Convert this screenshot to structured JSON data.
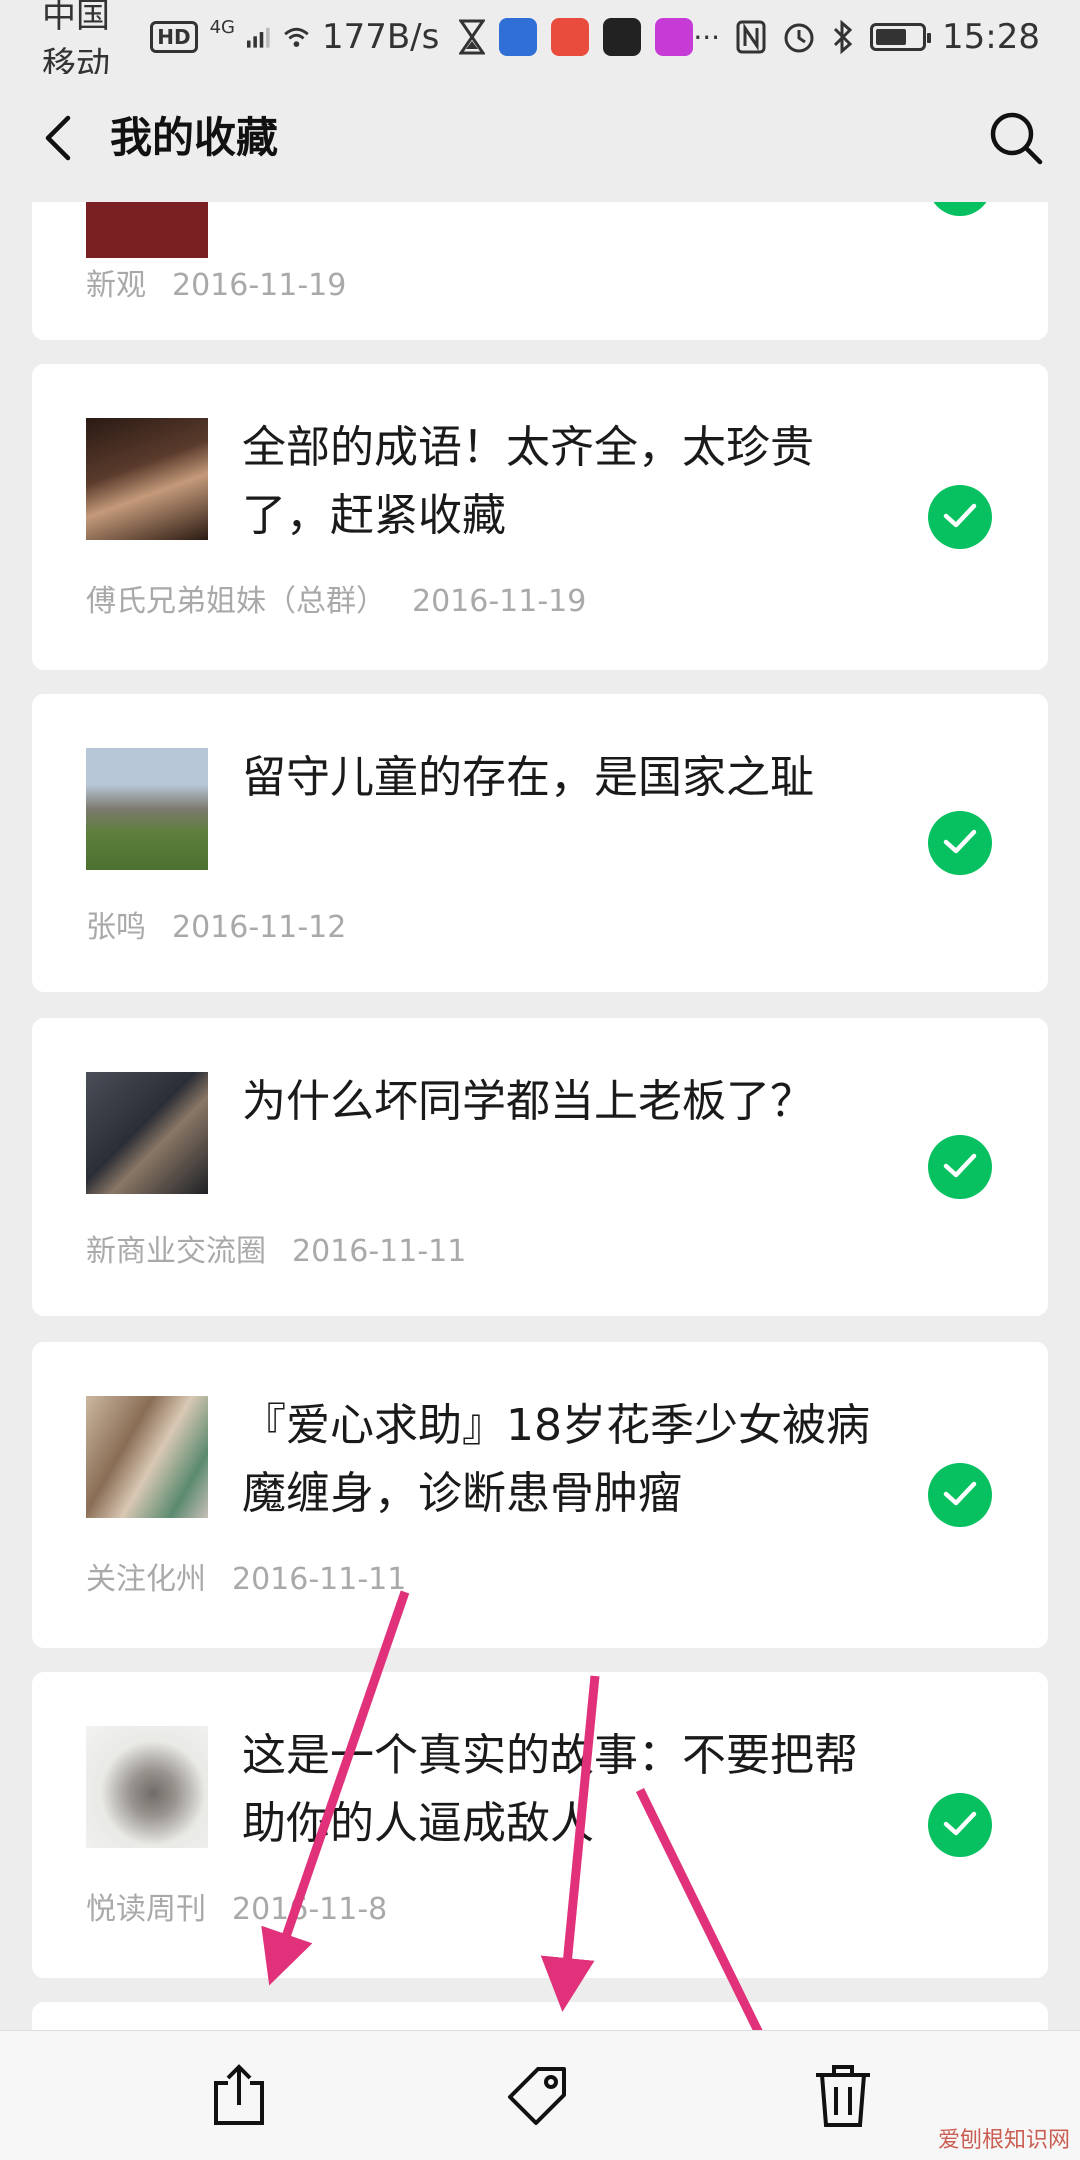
{
  "status_bar": {
    "carrier": "中国移动",
    "hd_badge": "HD",
    "network": "4G",
    "speed": "177B/s",
    "time": "15:28",
    "icons": [
      "hourglass-icon",
      "baidu-icon",
      "app-icon",
      "video-app-icon",
      "app-icon-2",
      "more-dots",
      "nfc-icon",
      "alarm-icon",
      "bluetooth-icon",
      "battery-icon"
    ]
  },
  "nav": {
    "title": "我的收藏"
  },
  "items": [
    {
      "title": "",
      "source": "新观",
      "date": "2016-11-19",
      "thumb_color": "#7a1f22"
    },
    {
      "title": "全部的成语！太齐全，太珍贵了，赶紧收藏",
      "source": "傅氏兄弟姐妹（总群）",
      "date": "2016-11-19",
      "thumb_color": "#3a2418"
    },
    {
      "title": "留守儿童的存在，是国家之耻",
      "source": "张鸣",
      "date": "2016-11-12",
      "thumb_color": "#6c8b52"
    },
    {
      "title": "为什么坏同学都当上老板了？",
      "source": "新商业交流圈",
      "date": "2016-11-11",
      "thumb_color": "#2b2e36"
    },
    {
      "title": "『爱心求助』18岁花季少女被病魔缠身，诊断患骨肿瘤",
      "source": "关注化州",
      "date": "2016-11-11",
      "thumb_color": "#a58a70"
    },
    {
      "title": "这是一个真实的故事：不要把帮助你的人逼成敌人",
      "source": "悦读周刊",
      "date": "2016-11-8",
      "thumb_color": "#b9b9b4"
    }
  ],
  "bottom_bar": {
    "buttons": [
      "share-icon",
      "tag-icon",
      "trash-icon"
    ]
  },
  "colors": {
    "accent_check": "#07c160",
    "annotation_arrow": "#e0317a"
  },
  "watermark": "爱刨根知识网"
}
